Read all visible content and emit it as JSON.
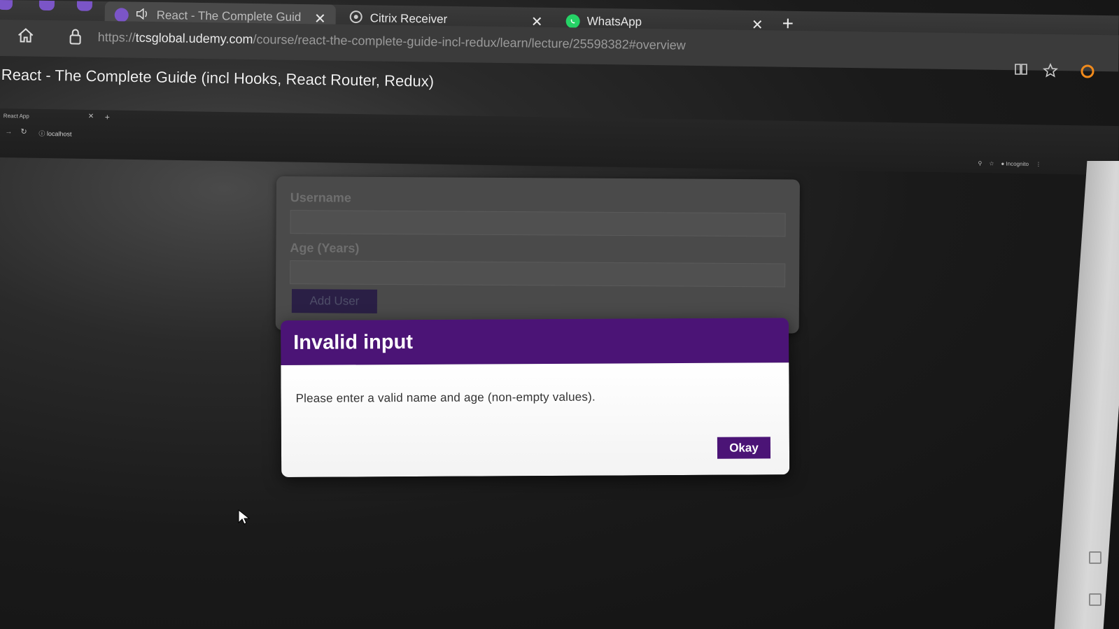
{
  "browser": {
    "tabs": [
      {
        "label": "React - The Complete Guid",
        "active": true
      },
      {
        "label": "Citrix Receiver",
        "active": false
      },
      {
        "label": "WhatsApp",
        "active": false
      }
    ],
    "new_tab_symbol": "+",
    "close_symbol": "✕",
    "url_scheme": "https://",
    "url_host": "tcsglobal.udemy.com",
    "url_path": "/course/react-the-complete-guide-incl-redux/learn/lecture/25598382#overview"
  },
  "page": {
    "title": "React - The Complete Guide (incl Hooks, React Router, Redux)"
  },
  "inner_browser": {
    "tab_label": "React App",
    "url": "localhost",
    "profile_label": "Incognito"
  },
  "app": {
    "username_label": "Username",
    "age_label": "Age (Years)",
    "add_user_label": "Add User"
  },
  "modal": {
    "title": "Invalid input",
    "message": "Please enter a valid name and age (non-empty values).",
    "okay_label": "Okay"
  },
  "colors": {
    "modal_header": "#4b1476",
    "okay_button": "#4b1476",
    "whatsapp": "#25d366",
    "tab_badge": "#7b55c7"
  },
  "icons": [
    "home-icon",
    "lock-icon",
    "reading-view-icon",
    "favorites-icon",
    "extension-icon",
    "citrix-icon",
    "whatsapp-icon",
    "speaker-icon",
    "mouse-pointer-icon"
  ]
}
